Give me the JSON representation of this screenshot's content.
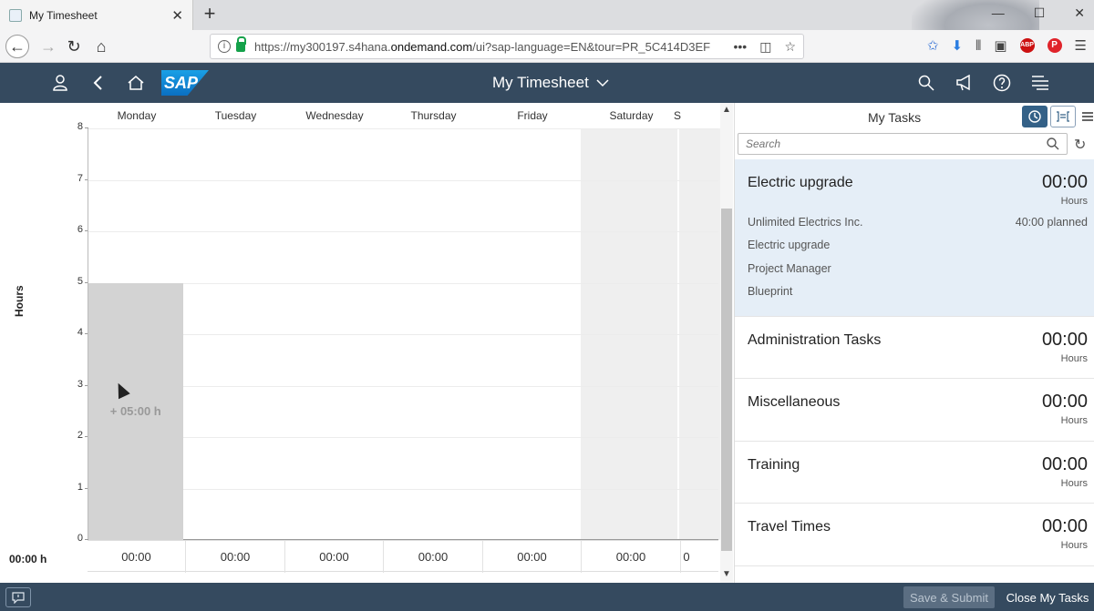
{
  "browser": {
    "tab_title": "My Timesheet",
    "url_prefix": "https://my300197.s4hana.",
    "url_domain": "ondemand.com",
    "url_suffix": "/ui?sap-language=EN&tour=PR_5C414D3EF"
  },
  "shell": {
    "title": "My Timesheet"
  },
  "chart_data": {
    "type": "bar",
    "categories": [
      "Monday",
      "Tuesday",
      "Wednesday",
      "Thursday",
      "Friday",
      "Saturday",
      "S"
    ],
    "values": [
      5,
      0,
      0,
      0,
      0,
      0,
      0
    ],
    "ylabel": "Hours",
    "ylim": [
      0,
      8
    ],
    "yticks": [
      "0",
      "1",
      "2",
      "3",
      "4",
      "5",
      "6",
      "7",
      "8"
    ],
    "bar_labels": [
      "+ 05:00 h",
      "",
      "",
      "",
      "",
      "",
      ""
    ],
    "totals": [
      "00:00",
      "00:00",
      "00:00",
      "00:00",
      "00:00",
      "00:00",
      "0"
    ],
    "grand_total": "00:00 h",
    "weekend_columns": [
      5,
      6
    ],
    "bar_color": "#d3d3d3"
  },
  "tasks": {
    "title": "My Tasks",
    "search_placeholder": "Search",
    "items": [
      {
        "name": "Electric upgrade",
        "hours": "00:00",
        "unit": "Hours",
        "planned": "40:00 planned",
        "details": [
          "Unlimited Electrics Inc.",
          "Electric upgrade",
          "Project Manager",
          "Blueprint"
        ]
      },
      {
        "name": "Administration Tasks",
        "hours": "00:00",
        "unit": "Hours"
      },
      {
        "name": "Miscellaneous",
        "hours": "00:00",
        "unit": "Hours"
      },
      {
        "name": "Training",
        "hours": "00:00",
        "unit": "Hours"
      },
      {
        "name": "Travel Times",
        "hours": "00:00",
        "unit": "Hours"
      }
    ]
  },
  "footer": {
    "save_submit": "Save & Submit",
    "close_tasks": "Close My Tasks"
  },
  "colors": {
    "shell": "#354a5f",
    "selected_task": "#e5eef7",
    "accent": "#346187"
  }
}
